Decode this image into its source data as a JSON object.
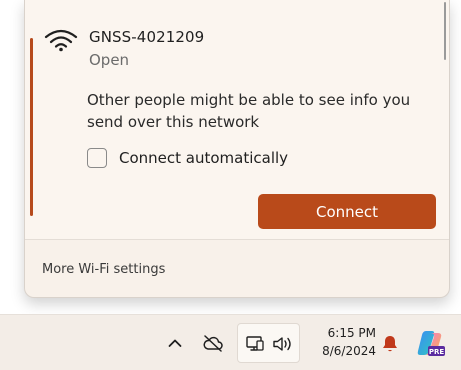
{
  "network": {
    "name": "GNSS-4021209",
    "status": "Open",
    "warning": "Other people might be able to see info you send over this network",
    "auto_connect_label": "Connect automatically",
    "auto_connect_checked": false,
    "connect_label": "Connect",
    "icon": "wifi-icon"
  },
  "flyout": {
    "more_settings_label": "More Wi-Fi settings"
  },
  "taskbar": {
    "time": "6:15 PM",
    "date": "8/6/2024",
    "copilot_badge": "PRE",
    "icons": [
      "chevron-up-icon",
      "cloud-off-icon",
      "network-icon",
      "volume-icon",
      "bell-icon",
      "copilot-icon"
    ]
  },
  "colors": {
    "accent": "#b94a1a",
    "flyout_bg": "#f8f1ea",
    "taskbar_bg": "#f3ede7"
  }
}
